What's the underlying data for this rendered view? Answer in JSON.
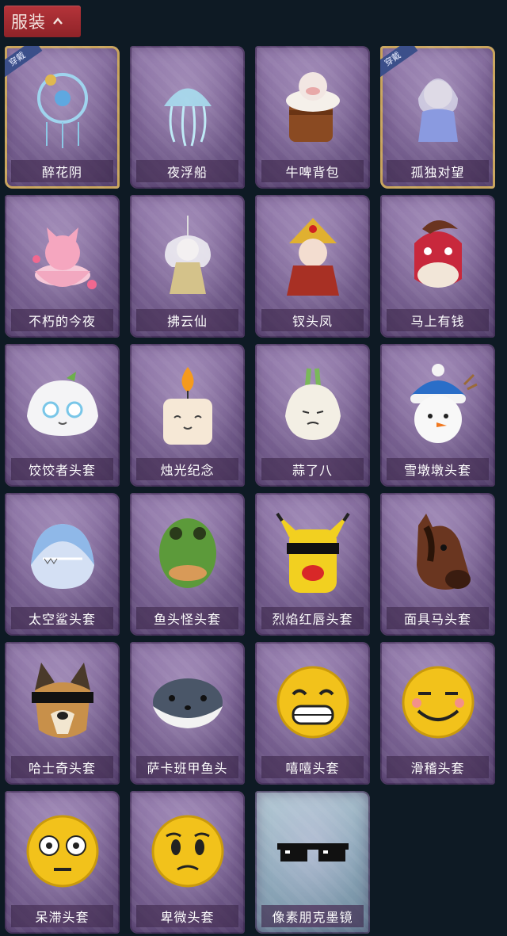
{
  "header": {
    "title": "服装"
  },
  "items": [
    {
      "name": "醉花阴",
      "equipped": true,
      "badge": "穿戴",
      "icon": "floral-pendant"
    },
    {
      "name": "夜浮船",
      "equipped": false,
      "icon": "jellyfish-pendant"
    },
    {
      "name": "牛啤背包",
      "equipped": false,
      "icon": "cow-beer-mug"
    },
    {
      "name": "孤独对望",
      "equipped": true,
      "badge": "穿戴",
      "icon": "doll-pendant"
    },
    {
      "name": "不朽的今夜",
      "equipped": false,
      "icon": "pink-cat-bowl"
    },
    {
      "name": "拂云仙",
      "equipped": false,
      "icon": "fairy-pendant"
    },
    {
      "name": "钗头凤",
      "equipped": false,
      "icon": "opera-doll"
    },
    {
      "name": "马上有钱",
      "equipped": false,
      "icon": "red-horse-head"
    },
    {
      "name": "饺饺者头套",
      "equipped": false,
      "icon": "dumpling-head"
    },
    {
      "name": "烛光纪念",
      "equipped": false,
      "icon": "candle-head"
    },
    {
      "name": "蒜了八",
      "equipped": false,
      "icon": "garlic-head"
    },
    {
      "name": "雪墩墩头套",
      "equipped": false,
      "icon": "snowman-head"
    },
    {
      "name": "太空鲨头套",
      "equipped": false,
      "icon": "shark-head"
    },
    {
      "name": "鱼头怪头套",
      "equipped": false,
      "icon": "fish-head"
    },
    {
      "name": "烈焰红唇头套",
      "equipped": false,
      "icon": "pikachu-mask"
    },
    {
      "name": "面具马头套",
      "equipped": false,
      "icon": "horse-mask"
    },
    {
      "name": "哈士奇头套",
      "equipped": false,
      "icon": "husky-head"
    },
    {
      "name": "萨卡班甲鱼头",
      "equipped": false,
      "icon": "sacabambaspis-head"
    },
    {
      "name": "嘻嘻头套",
      "equipped": false,
      "icon": "grin-emoji-head"
    },
    {
      "name": "滑稽头套",
      "equipped": false,
      "icon": "smirk-emoji-head"
    },
    {
      "name": "呆滞头套",
      "equipped": false,
      "icon": "stunned-emoji-head"
    },
    {
      "name": "卑微头套",
      "equipped": false,
      "icon": "pleading-emoji-head"
    },
    {
      "name": "像素朋克墨镜",
      "equipped": false,
      "special": true,
      "icon": "pixel-sunglasses"
    }
  ]
}
